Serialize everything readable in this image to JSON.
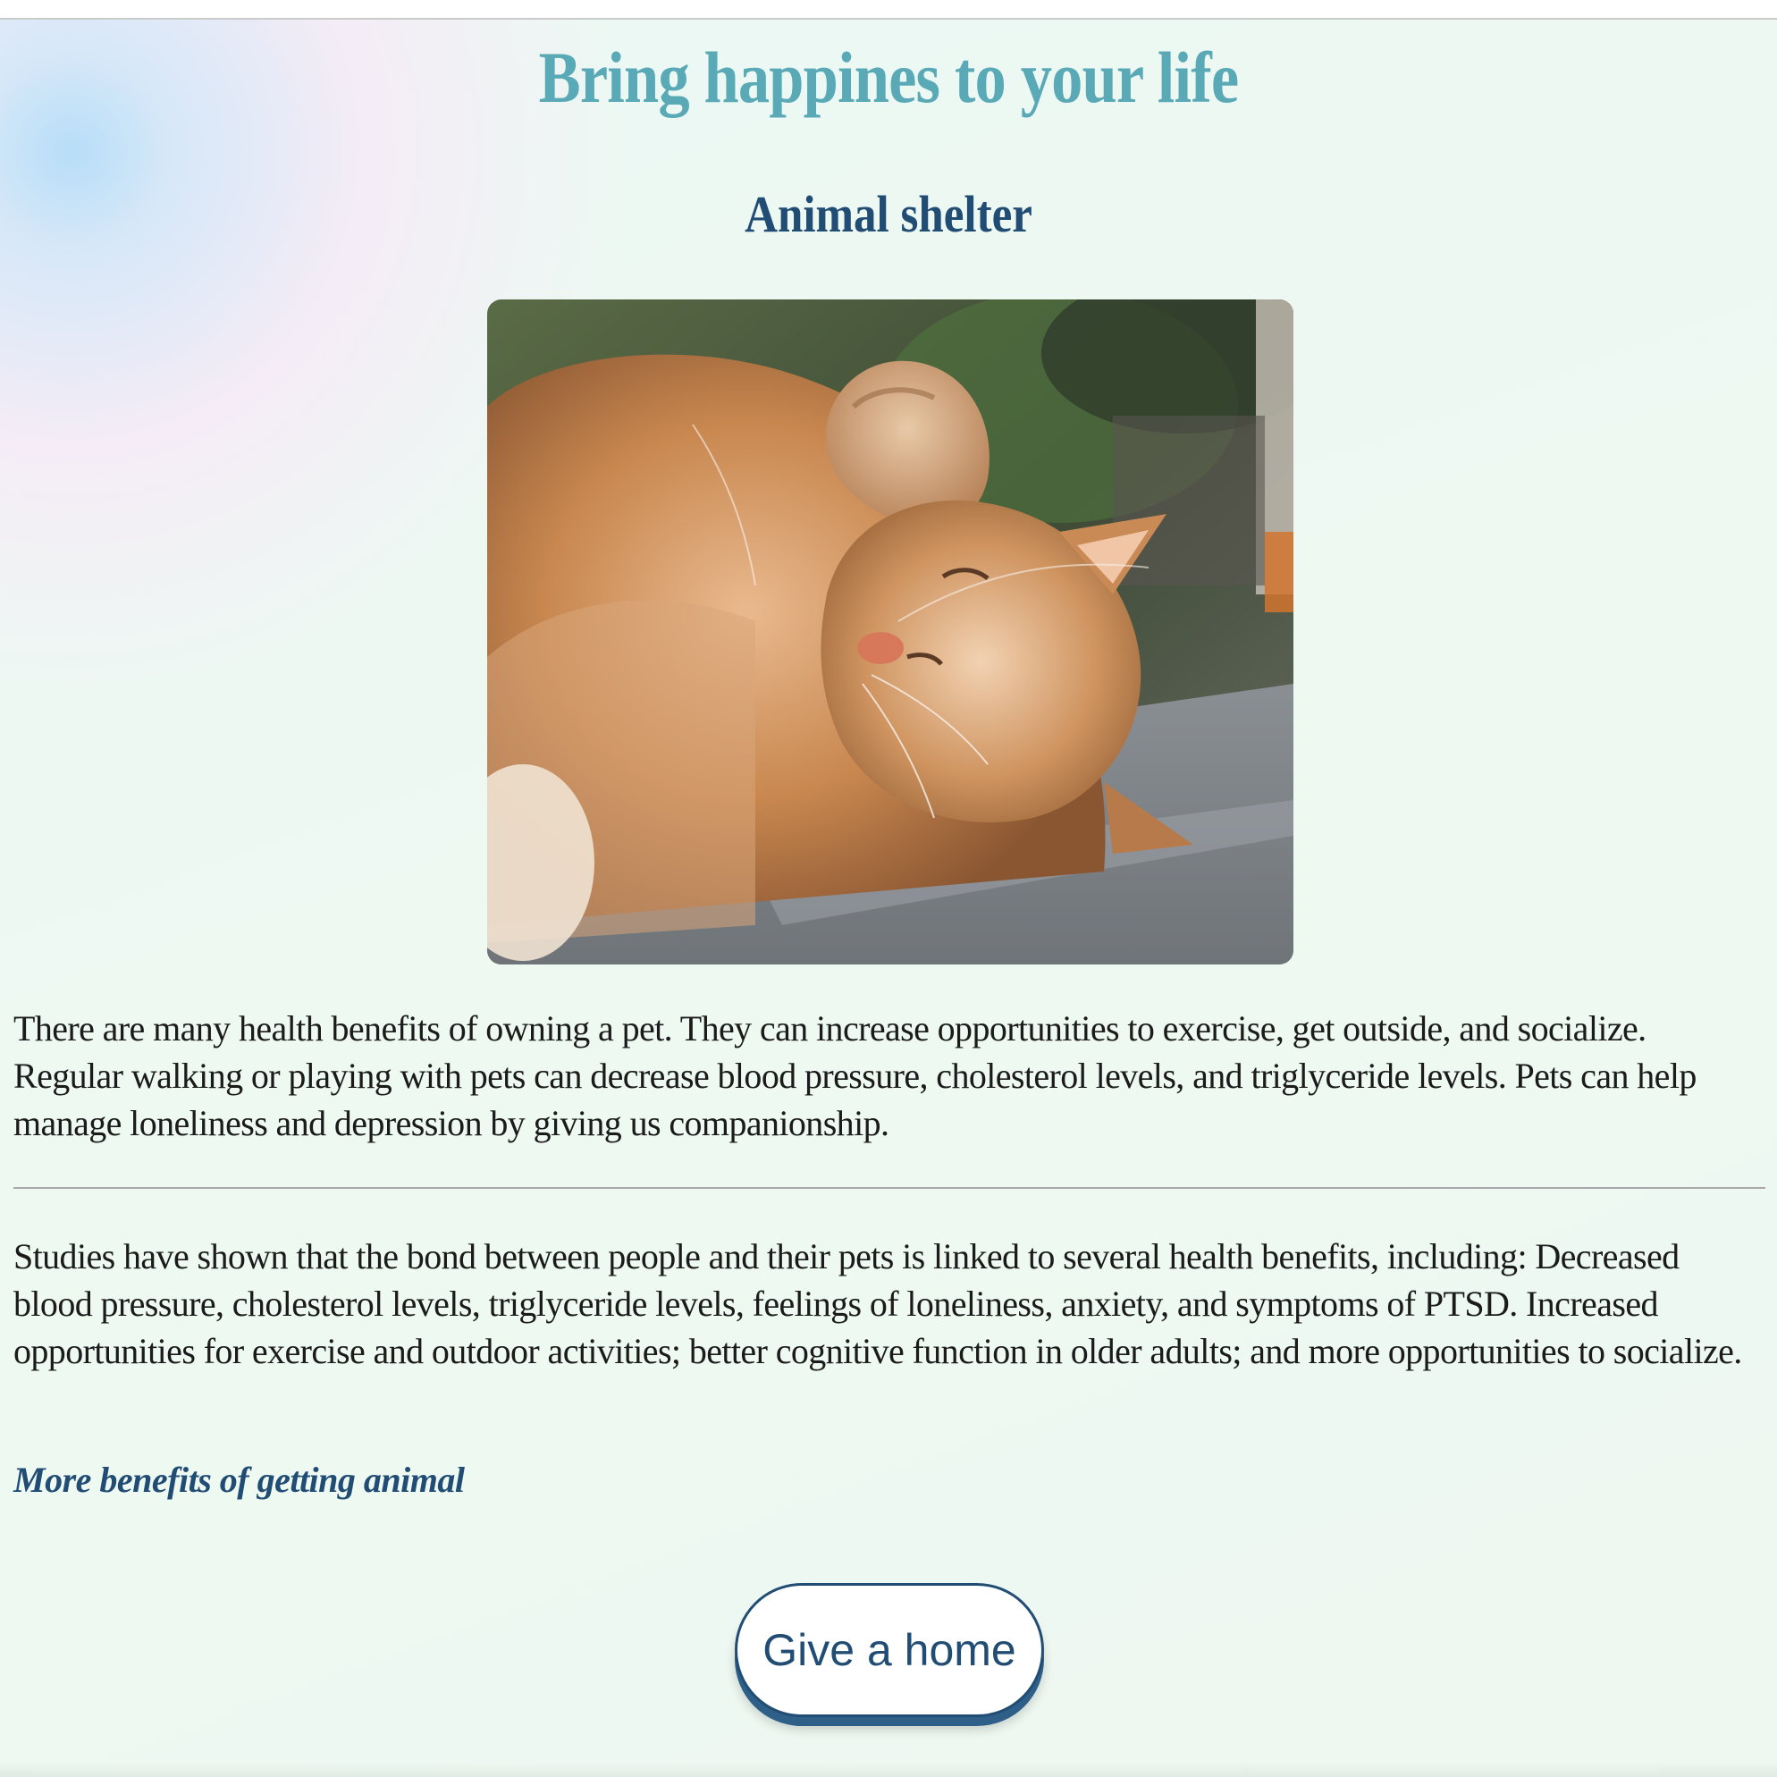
{
  "page": {
    "headline": "Bring happines to your life",
    "subheadline": "Animal shelter"
  },
  "image": {
    "subject": "orange-tabby-cat-sleeping-photo"
  },
  "content": {
    "paragraph_1": "There are many health benefits of owning a pet. They can increase opportunities to exercise, get outside, and socialize. Regular walking or playing with pets can decrease blood pressure, cholesterol levels, and triglyceride levels. Pets can help manage loneliness and depression by giving us companionship.",
    "paragraph_2": "Studies have shown that the bond between people and their pets is linked to several health benefits, including: Decreased blood pressure, cholesterol levels, triglyceride levels, feelings of loneliness, anxiety, and symptoms of PTSD. Increased opportunities for exercise and outdoor activities; better cognitive function in older adults; and more opportunities to socialize.",
    "more_link": "More benefits of getting animal"
  },
  "actions": {
    "cta_label": "Give a home"
  },
  "colors": {
    "headline": "#5aa9b6",
    "accent": "#214c73",
    "text": "#1b1b1b"
  }
}
